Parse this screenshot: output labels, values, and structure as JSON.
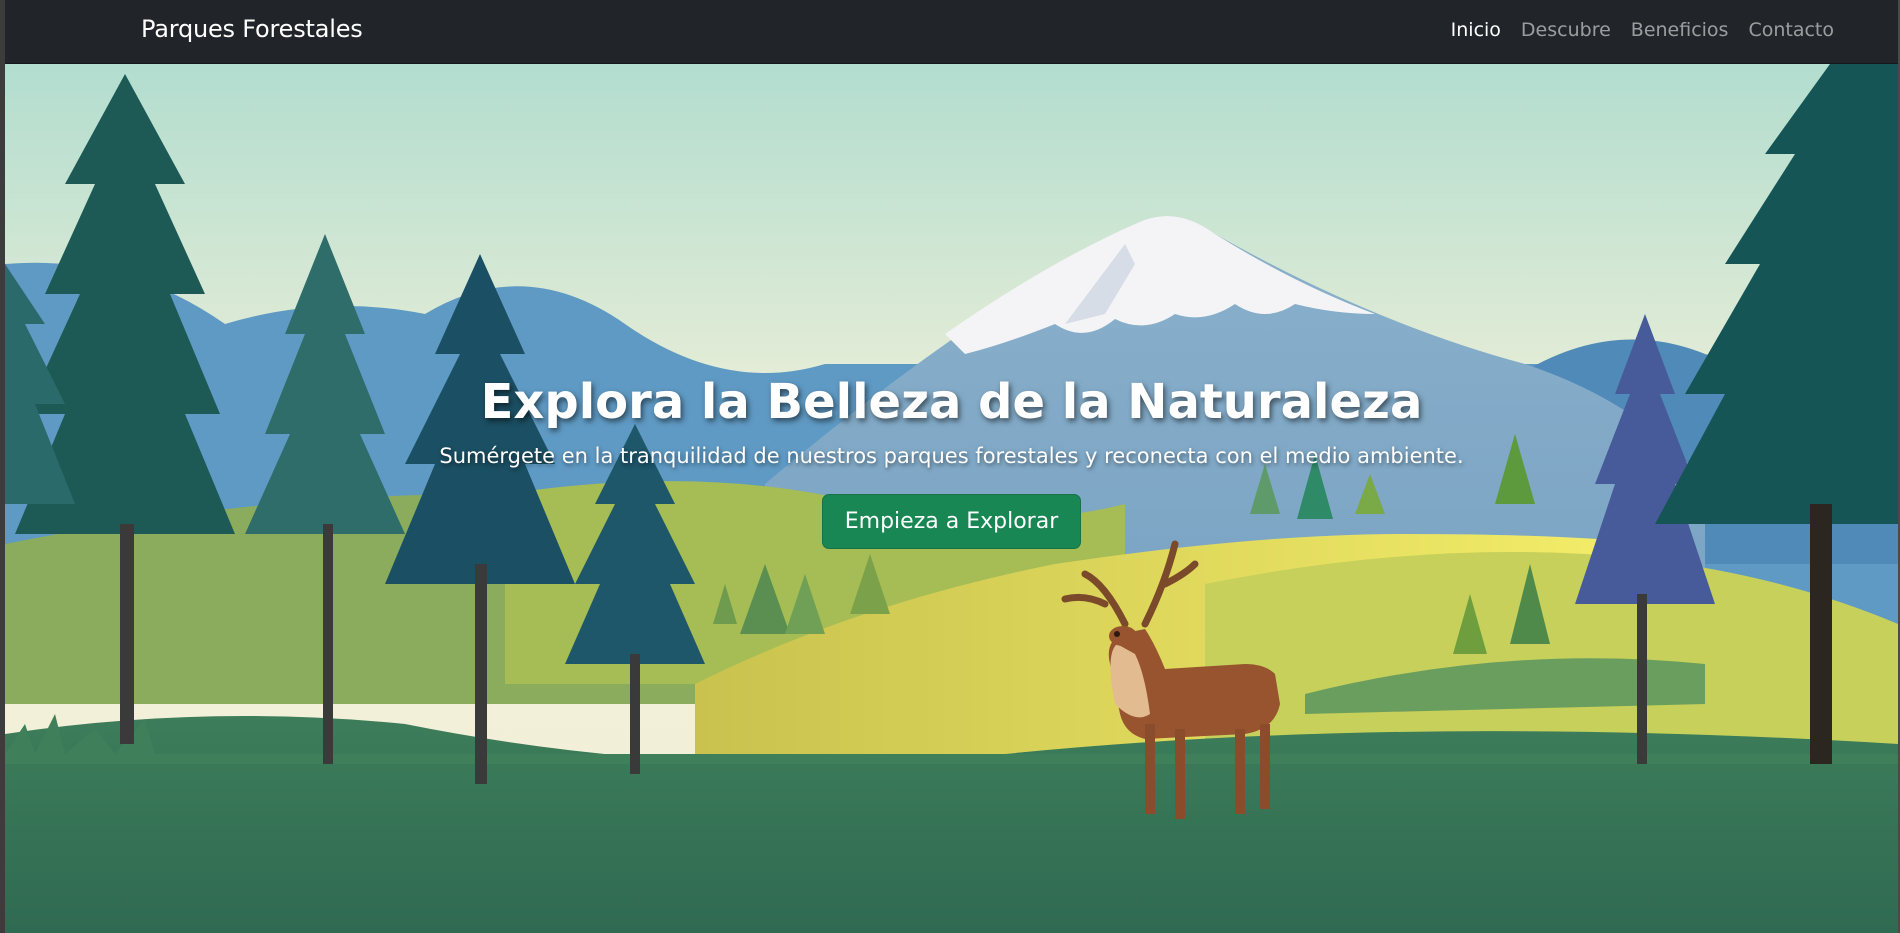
{
  "navbar": {
    "brand": "Parques Forestales",
    "links": [
      {
        "label": "Inicio",
        "active": true
      },
      {
        "label": "Descubre",
        "active": false
      },
      {
        "label": "Beneficios",
        "active": false
      },
      {
        "label": "Contacto",
        "active": false
      }
    ]
  },
  "hero": {
    "title": "Explora la Belleza de la Naturaleza",
    "subtitle": "Sumérgete en la tranquilidad de nuestros parques forestales y reconecta con el medio ambiente.",
    "button_label": "Empieza a Explorar",
    "illustration": "forest-landscape-with-snowy-mountain-and-deer"
  },
  "colors": {
    "navbar_bg": "#212529",
    "button_bg": "#198754",
    "sky_top": "#b3dfcf",
    "sky_bottom": "#f3f1d8",
    "meadow_yellow": "#f2ea64",
    "grass_dark": "#2f6e52"
  }
}
